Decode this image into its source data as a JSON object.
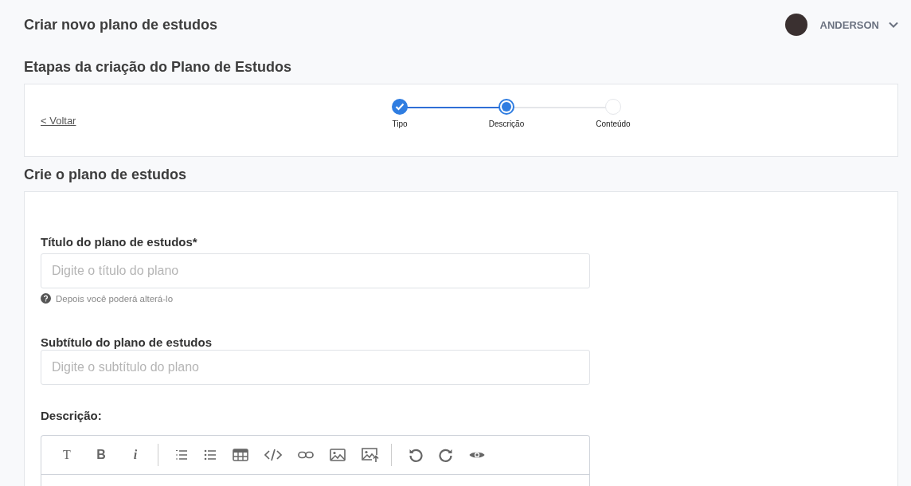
{
  "header": {
    "title": "Criar novo plano de estudos",
    "user": {
      "name": "ANDERSON"
    }
  },
  "steps_section": {
    "title": "Etapas da criação do Plano de Estudos",
    "back_link": "< Voltar",
    "steps": [
      {
        "label": "Tipo",
        "completed": true,
        "selected": false
      },
      {
        "label": "Descrição",
        "completed": false,
        "selected": true
      },
      {
        "label": "Conteúdo",
        "completed": false,
        "selected": false
      }
    ]
  },
  "form_section": {
    "title": "Crie o plano de estudos",
    "title_field": {
      "label": "Título do plano de estudos*",
      "placeholder": "Digite o título do plano",
      "hint": "Depois você poderá alterá-lo"
    },
    "subtitle_field": {
      "label": "Subtítulo do plano de estudos",
      "placeholder": "Digite o subtítulo do plano"
    },
    "description": {
      "label": "Descrição:",
      "format_buttons": [
        "T",
        "B",
        "i"
      ]
    }
  }
}
